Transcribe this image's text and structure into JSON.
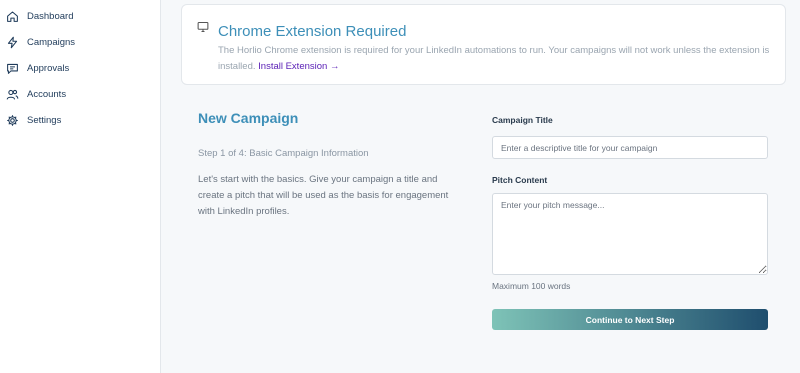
{
  "sidebar": {
    "items": [
      {
        "label": "Dashboard",
        "icon": "home-icon"
      },
      {
        "label": "Campaigns",
        "icon": "lightning-icon"
      },
      {
        "label": "Approvals",
        "icon": "message-icon"
      },
      {
        "label": "Accounts",
        "icon": "users-icon"
      },
      {
        "label": "Settings",
        "icon": "gear-icon"
      }
    ]
  },
  "banner": {
    "icon": "monitor-icon",
    "title": "Chrome Extension Required",
    "body": "The Horlio Chrome extension is required for your LinkedIn automations to run. Your campaigns will not work unless the extension is installed.",
    "link": "Install Extension →"
  },
  "campaign": {
    "title": "New Campaign",
    "step": "Step 1 of 4: Basic Campaign Information",
    "description": "Let's start with the basics. Give your campaign a title and create a pitch that will be used as the basis for engagement with LinkedIn profiles."
  },
  "form": {
    "title_label": "Campaign Title",
    "title_placeholder": "Enter a descriptive title for your campaign",
    "title_value": "",
    "pitch_label": "Pitch Content",
    "pitch_placeholder": "Enter your pitch message...",
    "pitch_value": "",
    "pitch_hint": "Maximum 100 words",
    "submit_label": "Continue to Next Step"
  },
  "colors": {
    "accent": "#3d8fb8",
    "link": "#5b21b6",
    "button_gradient_start": "#7ec3b7",
    "button_gradient_end": "#1f4e6e"
  }
}
